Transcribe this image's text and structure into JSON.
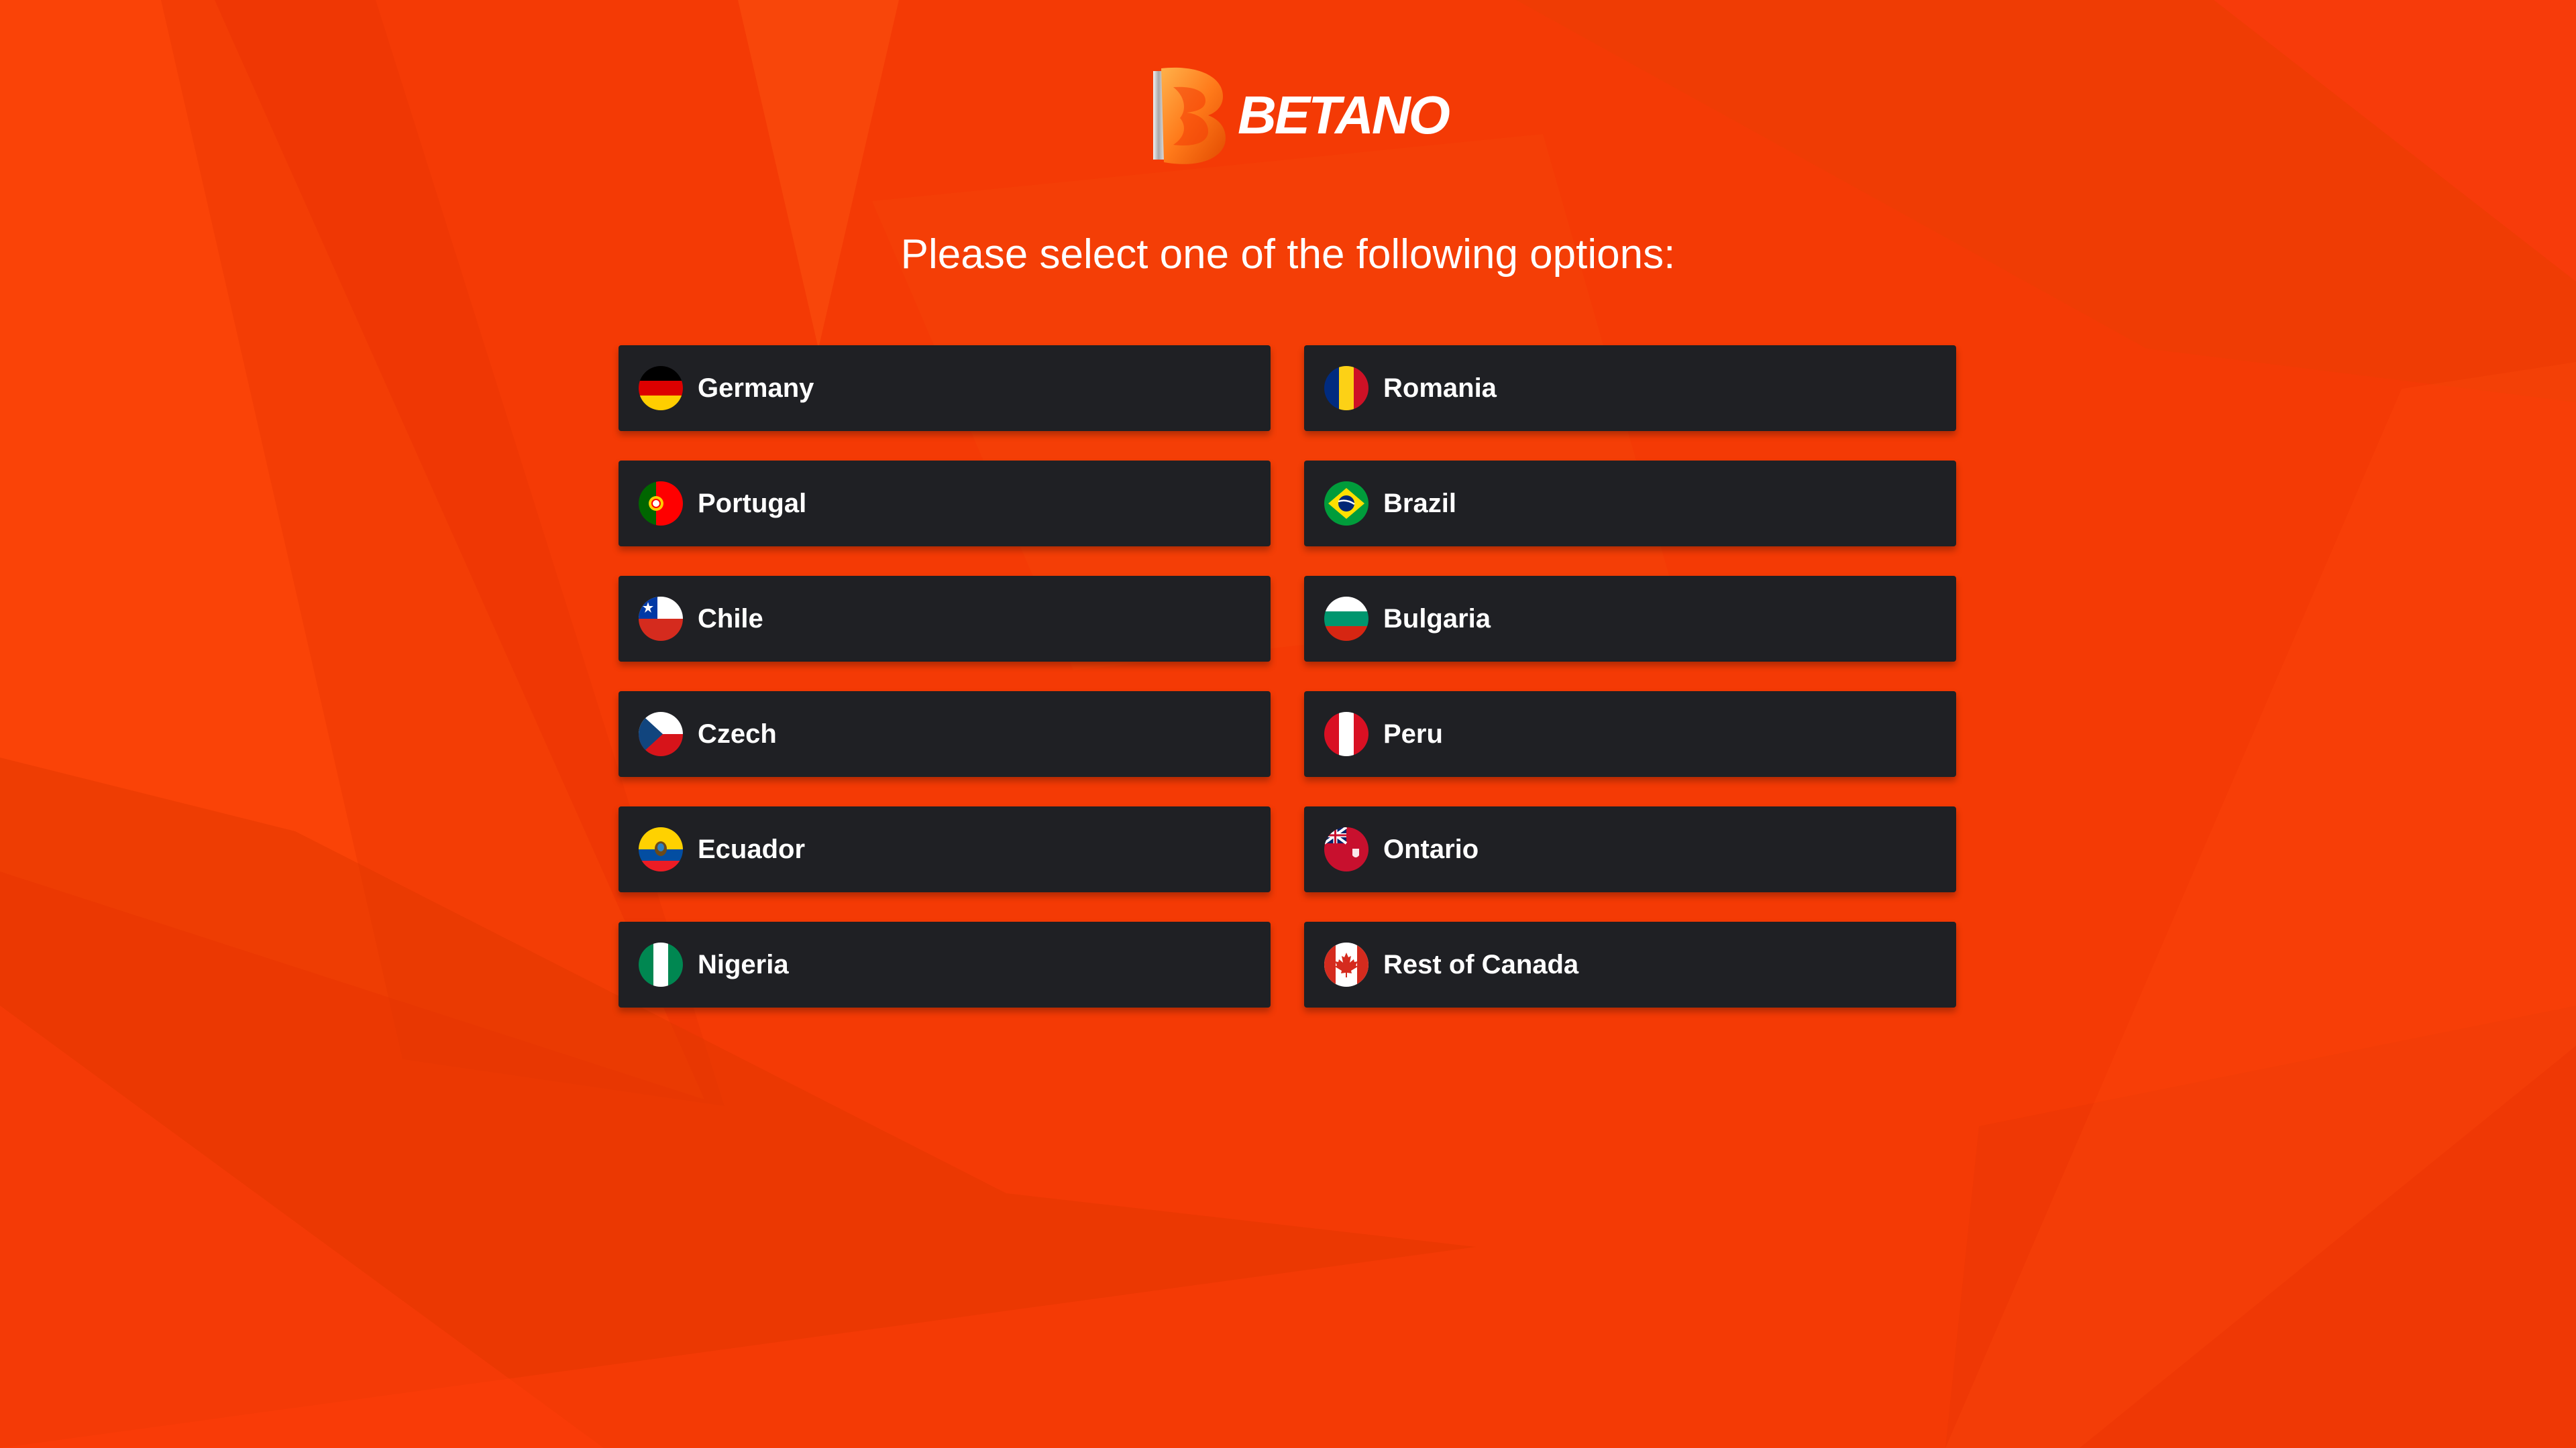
{
  "brand": {
    "name": "BETANO",
    "logo_icon": "betano-logo-icon"
  },
  "prompt": "Please select one of the following options:",
  "colors": {
    "background": "#f43a05",
    "button": "#1f2024",
    "text": "#ffffff"
  },
  "options": [
    {
      "label": "Germany",
      "icon": "germany-flag-icon"
    },
    {
      "label": "Romania",
      "icon": "romania-flag-icon"
    },
    {
      "label": "Portugal",
      "icon": "portugal-flag-icon"
    },
    {
      "label": "Brazil",
      "icon": "brazil-flag-icon"
    },
    {
      "label": "Chile",
      "icon": "chile-flag-icon"
    },
    {
      "label": "Bulgaria",
      "icon": "bulgaria-flag-icon"
    },
    {
      "label": "Czech",
      "icon": "czech-flag-icon"
    },
    {
      "label": "Peru",
      "icon": "peru-flag-icon"
    },
    {
      "label": "Ecuador",
      "icon": "ecuador-flag-icon"
    },
    {
      "label": "Ontario",
      "icon": "ontario-flag-icon"
    },
    {
      "label": "Nigeria",
      "icon": "nigeria-flag-icon"
    },
    {
      "label": "Rest of Canada",
      "icon": "canada-flag-icon"
    }
  ]
}
